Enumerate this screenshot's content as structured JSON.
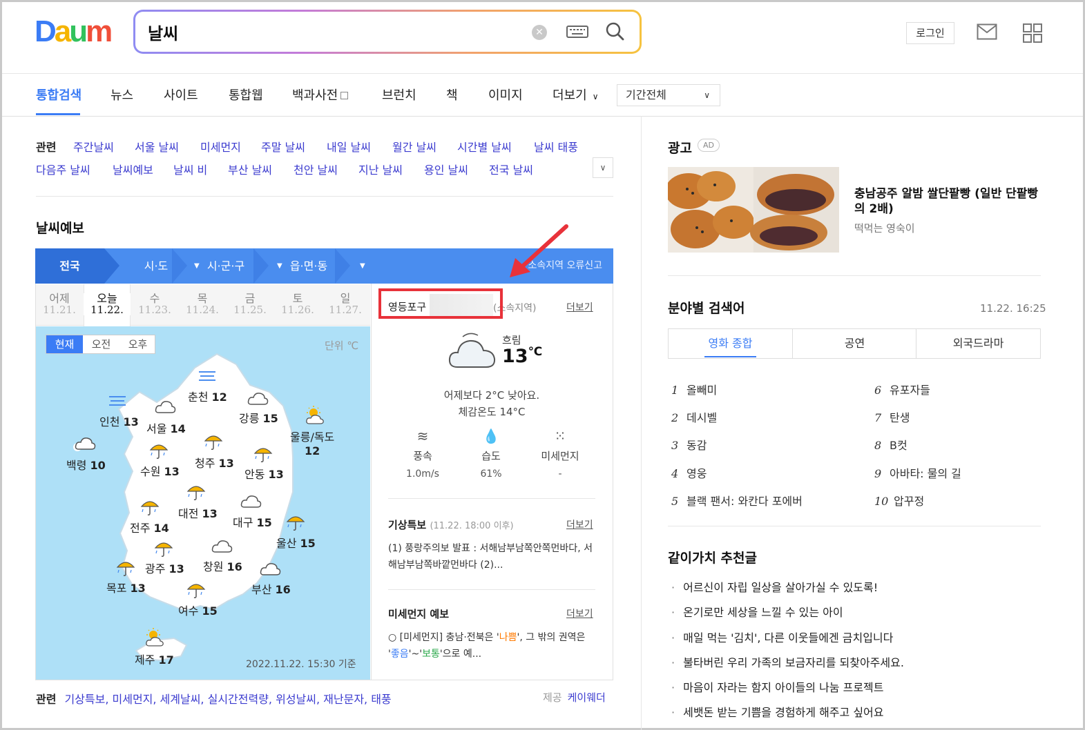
{
  "header": {
    "logo": [
      "D",
      "a",
      "u",
      "m"
    ],
    "search_value": "날씨",
    "login_label": "로그인"
  },
  "tabs": {
    "items": [
      "통합검색",
      "뉴스",
      "사이트",
      "통합웹",
      "백과사전",
      "브런치",
      "책",
      "이미지",
      "더보기"
    ],
    "period": "기간전체"
  },
  "related": {
    "title": "관련",
    "row1": [
      "주간날씨",
      "서울 날씨",
      "미세먼지",
      "주말 날씨",
      "내일 날씨",
      "월간 날씨",
      "시간별 날씨",
      "날씨 태풍"
    ],
    "row2": [
      "다음주 날씨",
      "날씨예보",
      "날씨 비",
      "부산 날씨",
      "천안 날씨",
      "지난 날씨",
      "용인 날씨",
      "전국 날씨"
    ]
  },
  "forecast": {
    "title": "날씨예보",
    "regions": [
      "전국",
      "시·도",
      "시·군·구",
      "읍·면·동"
    ],
    "region_error": "소속지역 오류신고",
    "days": [
      {
        "name": "어제",
        "date": "11.21."
      },
      {
        "name": "오늘",
        "date": "11.22."
      },
      {
        "name": "수",
        "date": "11.23."
      },
      {
        "name": "목",
        "date": "11.24."
      },
      {
        "name": "금",
        "date": "11.25."
      },
      {
        "name": "토",
        "date": "11.26."
      },
      {
        "name": "일",
        "date": "11.27."
      }
    ],
    "time_tabs": [
      "현재",
      "오전",
      "오후"
    ],
    "unit": "단위 ℃",
    "cities": [
      {
        "name": "춘천",
        "temp": "12",
        "icon": "fog"
      },
      {
        "name": "인천",
        "temp": "13",
        "icon": "fog"
      },
      {
        "name": "서울",
        "temp": "14",
        "icon": "cloud"
      },
      {
        "name": "강릉",
        "temp": "15",
        "icon": "cloud"
      },
      {
        "name": "울릉/독도",
        "temp": "12",
        "icon": "sun-cloud"
      },
      {
        "name": "백령",
        "temp": "10",
        "icon": "cloud"
      },
      {
        "name": "수원",
        "temp": "13",
        "icon": "umbrella"
      },
      {
        "name": "청주",
        "temp": "13",
        "icon": "umbrella"
      },
      {
        "name": "안동",
        "temp": "13",
        "icon": "umbrella"
      },
      {
        "name": "대전",
        "temp": "13",
        "icon": "umbrella"
      },
      {
        "name": "대구",
        "temp": "15",
        "icon": "cloud"
      },
      {
        "name": "전주",
        "temp": "14",
        "icon": "umbrella"
      },
      {
        "name": "울산",
        "temp": "15",
        "icon": "umbrella"
      },
      {
        "name": "광주",
        "temp": "13",
        "icon": "umbrella"
      },
      {
        "name": "창원",
        "temp": "16",
        "icon": "cloud"
      },
      {
        "name": "목포",
        "temp": "13",
        "icon": "umbrella"
      },
      {
        "name": "부산",
        "temp": "16",
        "icon": "cloud"
      },
      {
        "name": "여수",
        "temp": "15",
        "icon": "umbrella"
      },
      {
        "name": "제주",
        "temp": "17",
        "icon": "sun-cloud"
      }
    ],
    "timestamp": "2022.11.22. 15:30 기준",
    "location": "영등포구",
    "location_note": "(소속지역)",
    "more": "더보기",
    "condition": "흐림",
    "temperature": "13",
    "temp_unit": "℃",
    "compare": "어제보다 2°C 낮아요.",
    "feels_like": "체감온도 14°C",
    "stats": [
      {
        "label": "풍속",
        "value": "1.0m/s",
        "icon": "wind-icon"
      },
      {
        "label": "습도",
        "value": "61%",
        "icon": "humidity-icon"
      },
      {
        "label": "미세먼지",
        "value": "-",
        "icon": "dust-icon"
      }
    ],
    "special": {
      "title": "기상특보",
      "time": "(11.22. 18:00 이후)",
      "text": "(1) 풍랑주의보 발표 : 서해남부남쪽안쪽먼바다, 서해남부남쪽바깥먼바다 (2)..."
    },
    "dust": {
      "title": "미세먼지 예보",
      "text_prefix": "○ [미세먼지] 충남·전북은 '",
      "bad": "나쁨",
      "text_mid": "', 그 밖의 권역은 '",
      "good": "좋음",
      "tilde": "'~'",
      "normal": "보통",
      "text_suffix": "'으로 예..."
    },
    "bottom_related_title": "관련",
    "bottom_related": "기상특보, 미세먼지, 세계날씨, 실시간전력량, 위성날씨, 재난문자, 태풍",
    "provider_label": "제공",
    "provider": "케이웨더"
  },
  "ad": {
    "title": "광고",
    "badge": "AD",
    "headline": "충남공주 알밤 쌀단팥빵 (일반 단팥빵의 2배)",
    "sub": "떡먹는 영숙이"
  },
  "keywords": {
    "title": "분야별 검색어",
    "time": "11.22. 16:25",
    "tabs": [
      "영화 종합",
      "공연",
      "외국드라마"
    ],
    "left": [
      {
        "rank": "1",
        "text": "올빼미"
      },
      {
        "rank": "2",
        "text": "데시벨"
      },
      {
        "rank": "3",
        "text": "동감"
      },
      {
        "rank": "4",
        "text": "영웅"
      },
      {
        "rank": "5",
        "text": "블랙 팬서: 와칸다 포에버"
      }
    ],
    "right": [
      {
        "rank": "6",
        "text": "유포자들"
      },
      {
        "rank": "7",
        "text": "탄생"
      },
      {
        "rank": "8",
        "text": "B컷"
      },
      {
        "rank": "9",
        "text": "아바타: 물의 길"
      },
      {
        "rank": "10",
        "text": "압꾸정"
      }
    ]
  },
  "recommend": {
    "title": "같이가치 추천글",
    "items": [
      "어르신이 자립 일상을 살아가실 수 있도록!",
      "온기로만 세상을 느낄 수 있는 아이",
      "매일 먹는 '김치', 다른 이웃들에겐 금치입니다",
      "불타버린 우리 가족의 보금자리를 되찾아주세요.",
      "마음이 자라는 함지 아이들의 나눔 프로젝트",
      "세뱃돈 받는 기쁨을 경험하게 해주고 싶어요"
    ]
  }
}
